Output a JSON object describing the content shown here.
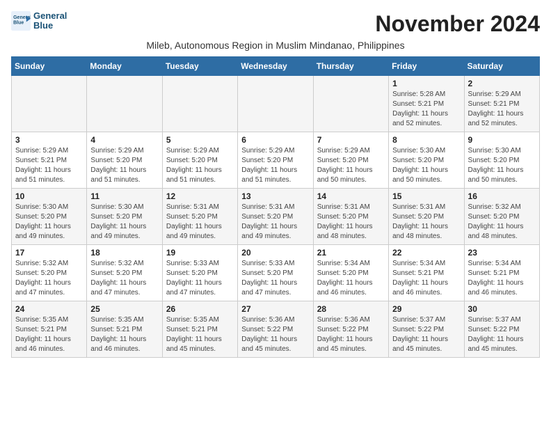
{
  "logo": {
    "line1": "General",
    "line2": "Blue"
  },
  "header": {
    "month": "November 2024",
    "location": "Mileb, Autonomous Region in Muslim Mindanao, Philippines"
  },
  "weekdays": [
    "Sunday",
    "Monday",
    "Tuesday",
    "Wednesday",
    "Thursday",
    "Friday",
    "Saturday"
  ],
  "weeks": [
    [
      {
        "day": "",
        "info": ""
      },
      {
        "day": "",
        "info": ""
      },
      {
        "day": "",
        "info": ""
      },
      {
        "day": "",
        "info": ""
      },
      {
        "day": "",
        "info": ""
      },
      {
        "day": "1",
        "info": "Sunrise: 5:28 AM\nSunset: 5:21 PM\nDaylight: 11 hours\nand 52 minutes."
      },
      {
        "day": "2",
        "info": "Sunrise: 5:29 AM\nSunset: 5:21 PM\nDaylight: 11 hours\nand 52 minutes."
      }
    ],
    [
      {
        "day": "3",
        "info": "Sunrise: 5:29 AM\nSunset: 5:21 PM\nDaylight: 11 hours\nand 51 minutes."
      },
      {
        "day": "4",
        "info": "Sunrise: 5:29 AM\nSunset: 5:20 PM\nDaylight: 11 hours\nand 51 minutes."
      },
      {
        "day": "5",
        "info": "Sunrise: 5:29 AM\nSunset: 5:20 PM\nDaylight: 11 hours\nand 51 minutes."
      },
      {
        "day": "6",
        "info": "Sunrise: 5:29 AM\nSunset: 5:20 PM\nDaylight: 11 hours\nand 51 minutes."
      },
      {
        "day": "7",
        "info": "Sunrise: 5:29 AM\nSunset: 5:20 PM\nDaylight: 11 hours\nand 50 minutes."
      },
      {
        "day": "8",
        "info": "Sunrise: 5:30 AM\nSunset: 5:20 PM\nDaylight: 11 hours\nand 50 minutes."
      },
      {
        "day": "9",
        "info": "Sunrise: 5:30 AM\nSunset: 5:20 PM\nDaylight: 11 hours\nand 50 minutes."
      }
    ],
    [
      {
        "day": "10",
        "info": "Sunrise: 5:30 AM\nSunset: 5:20 PM\nDaylight: 11 hours\nand 49 minutes."
      },
      {
        "day": "11",
        "info": "Sunrise: 5:30 AM\nSunset: 5:20 PM\nDaylight: 11 hours\nand 49 minutes."
      },
      {
        "day": "12",
        "info": "Sunrise: 5:31 AM\nSunset: 5:20 PM\nDaylight: 11 hours\nand 49 minutes."
      },
      {
        "day": "13",
        "info": "Sunrise: 5:31 AM\nSunset: 5:20 PM\nDaylight: 11 hours\nand 49 minutes."
      },
      {
        "day": "14",
        "info": "Sunrise: 5:31 AM\nSunset: 5:20 PM\nDaylight: 11 hours\nand 48 minutes."
      },
      {
        "day": "15",
        "info": "Sunrise: 5:31 AM\nSunset: 5:20 PM\nDaylight: 11 hours\nand 48 minutes."
      },
      {
        "day": "16",
        "info": "Sunrise: 5:32 AM\nSunset: 5:20 PM\nDaylight: 11 hours\nand 48 minutes."
      }
    ],
    [
      {
        "day": "17",
        "info": "Sunrise: 5:32 AM\nSunset: 5:20 PM\nDaylight: 11 hours\nand 47 minutes."
      },
      {
        "day": "18",
        "info": "Sunrise: 5:32 AM\nSunset: 5:20 PM\nDaylight: 11 hours\nand 47 minutes."
      },
      {
        "day": "19",
        "info": "Sunrise: 5:33 AM\nSunset: 5:20 PM\nDaylight: 11 hours\nand 47 minutes."
      },
      {
        "day": "20",
        "info": "Sunrise: 5:33 AM\nSunset: 5:20 PM\nDaylight: 11 hours\nand 47 minutes."
      },
      {
        "day": "21",
        "info": "Sunrise: 5:34 AM\nSunset: 5:20 PM\nDaylight: 11 hours\nand 46 minutes."
      },
      {
        "day": "22",
        "info": "Sunrise: 5:34 AM\nSunset: 5:21 PM\nDaylight: 11 hours\nand 46 minutes."
      },
      {
        "day": "23",
        "info": "Sunrise: 5:34 AM\nSunset: 5:21 PM\nDaylight: 11 hours\nand 46 minutes."
      }
    ],
    [
      {
        "day": "24",
        "info": "Sunrise: 5:35 AM\nSunset: 5:21 PM\nDaylight: 11 hours\nand 46 minutes."
      },
      {
        "day": "25",
        "info": "Sunrise: 5:35 AM\nSunset: 5:21 PM\nDaylight: 11 hours\nand 46 minutes."
      },
      {
        "day": "26",
        "info": "Sunrise: 5:35 AM\nSunset: 5:21 PM\nDaylight: 11 hours\nand 45 minutes."
      },
      {
        "day": "27",
        "info": "Sunrise: 5:36 AM\nSunset: 5:22 PM\nDaylight: 11 hours\nand 45 minutes."
      },
      {
        "day": "28",
        "info": "Sunrise: 5:36 AM\nSunset: 5:22 PM\nDaylight: 11 hours\nand 45 minutes."
      },
      {
        "day": "29",
        "info": "Sunrise: 5:37 AM\nSunset: 5:22 PM\nDaylight: 11 hours\nand 45 minutes."
      },
      {
        "day": "30",
        "info": "Sunrise: 5:37 AM\nSunset: 5:22 PM\nDaylight: 11 hours\nand 45 minutes."
      }
    ]
  ]
}
